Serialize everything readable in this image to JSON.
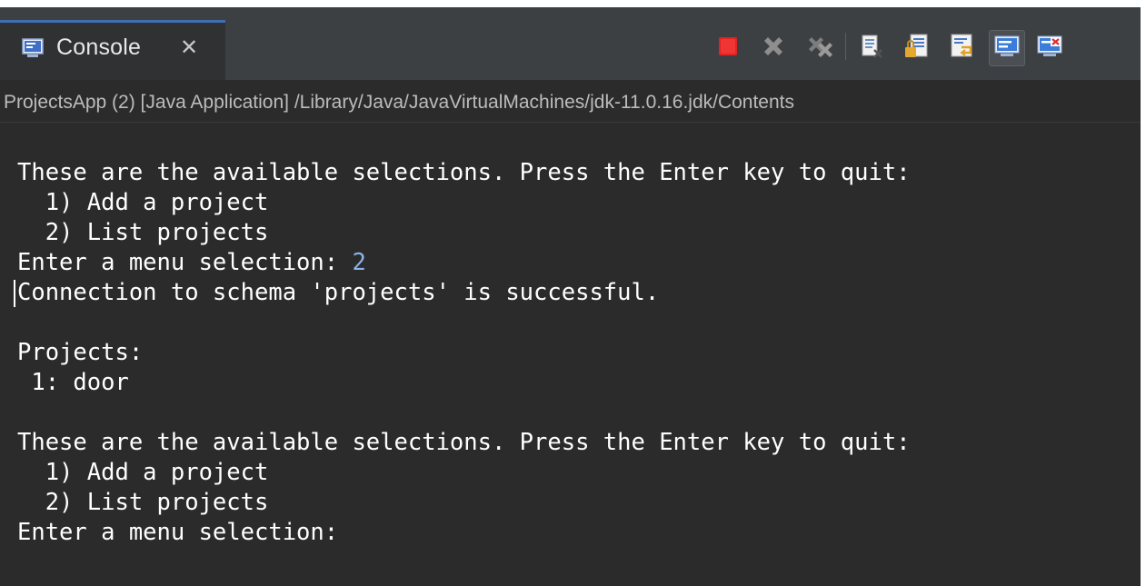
{
  "tab": {
    "title": "Console",
    "close_glyph": "✕",
    "icon": "console-icon"
  },
  "toolbar": {
    "buttons": [
      {
        "name": "terminate-icon",
        "color": "#e02020"
      },
      {
        "name": "remove-launch-icon",
        "color": "#8a8a8a"
      },
      {
        "name": "remove-all-terminated-icon",
        "color": "#8a8a8a"
      },
      {
        "name": "clear-console-icon",
        "color": "#d7d7d7"
      },
      {
        "name": "scroll-lock-icon",
        "color": "#e8b64a"
      },
      {
        "name": "word-wrap-icon",
        "color": "#d7d7d7"
      },
      {
        "name": "show-console-on-stdout-icon",
        "color": "#3b7dd8"
      },
      {
        "name": "show-console-on-stderr-icon",
        "color": "#d84040"
      }
    ]
  },
  "path": "ProjectsApp (2) [Java Application] /Library/Java/JavaVirtualMachines/jdk-11.0.16.jdk/Contents",
  "console": {
    "lines": [
      {
        "text": "These are the available selections. Press the Enter key to quit:",
        "input": ""
      },
      {
        "text": "  1) Add a project",
        "input": ""
      },
      {
        "text": "  2) List projects",
        "input": ""
      },
      {
        "text": "Enter a menu selection: ",
        "input": "2"
      },
      {
        "text": "Connection to schema 'projects' is successful.",
        "input": ""
      },
      {
        "text": "",
        "input": ""
      },
      {
        "text": "Projects:",
        "input": ""
      },
      {
        "text": " 1: door",
        "input": ""
      },
      {
        "text": "",
        "input": ""
      },
      {
        "text": "These are the available selections. Press the Enter key to quit:",
        "input": ""
      },
      {
        "text": "  1) Add a project",
        "input": ""
      },
      {
        "text": "  2) List projects",
        "input": ""
      },
      {
        "text": "Enter a menu selection:",
        "input": ""
      }
    ]
  },
  "colors": {
    "background": "#2b2b2b",
    "text": "#ffffff",
    "user_input": "#8cb4e6",
    "tab_accent": "#3c6fb3"
  }
}
